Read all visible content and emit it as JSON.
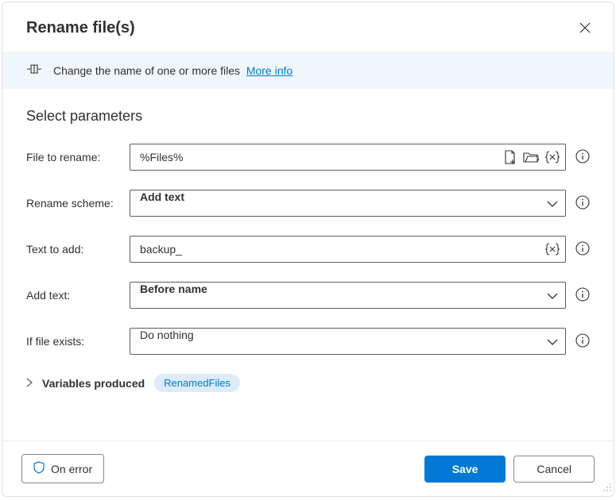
{
  "dialog": {
    "title": "Rename file(s)"
  },
  "banner": {
    "description": "Change the name of one or more files",
    "more_info": "More info"
  },
  "section": {
    "title": "Select parameters"
  },
  "fields": {
    "file_to_rename": {
      "label": "File to rename:",
      "value": "%Files%"
    },
    "rename_scheme": {
      "label": "Rename scheme:",
      "value": "Add text"
    },
    "text_to_add": {
      "label": "Text to add:",
      "value": "backup_"
    },
    "add_text": {
      "label": "Add text:",
      "value": "Before name"
    },
    "if_file_exists": {
      "label": "If file exists:",
      "value": "Do nothing"
    }
  },
  "variables": {
    "label": "Variables produced",
    "chip": "RenamedFiles"
  },
  "footer": {
    "on_error": "On error",
    "save": "Save",
    "cancel": "Cancel"
  }
}
